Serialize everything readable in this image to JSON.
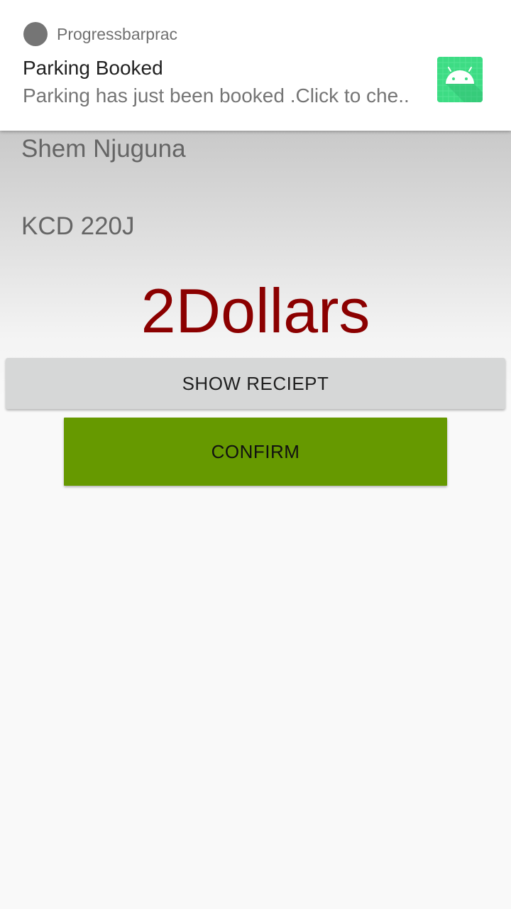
{
  "notification": {
    "app_name": "Progressbarprac",
    "title": "Parking Booked",
    "text": "Parking has just been booked .Click to che..",
    "large_icon": "android-robot-icon",
    "app_icon": "app-small-icon",
    "large_icon_color": "#3ddc84"
  },
  "booking": {
    "user_name": "Shem Njuguna",
    "plate": "KCD 220J",
    "price": "2Dollars",
    "price_color": "#8b0000"
  },
  "buttons": {
    "show_receipt_label": "SHOW RECIEPT",
    "confirm_label": "CONFIRM",
    "confirm_color": "#669900"
  }
}
